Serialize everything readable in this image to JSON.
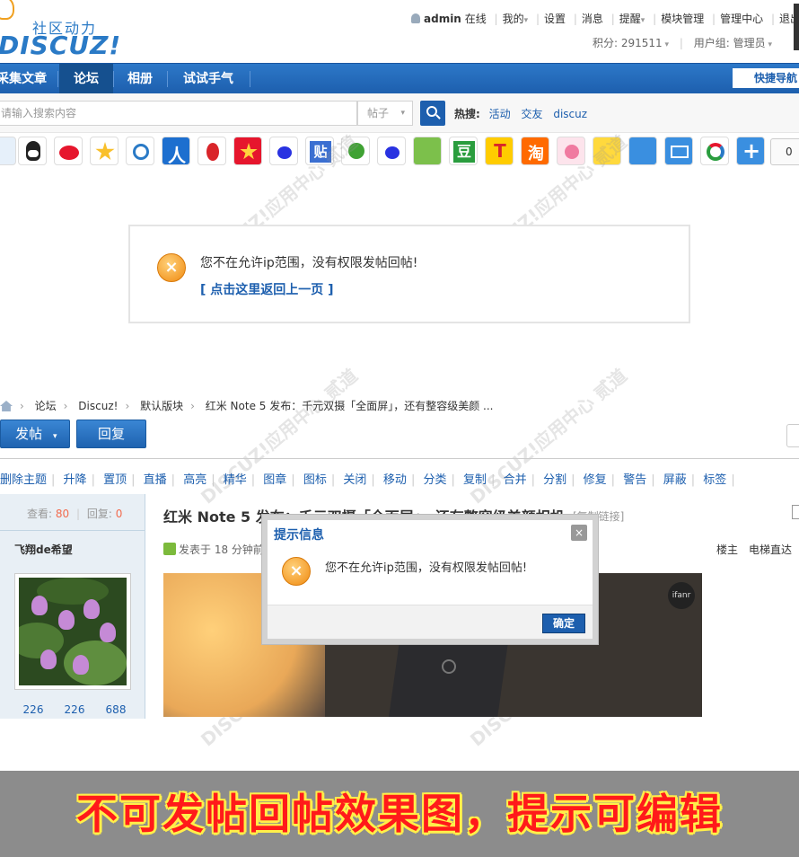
{
  "header": {
    "logo_sub": "社区动力",
    "logo_main": "DISCUZ!",
    "user": "admin",
    "online": "在线",
    "links": [
      "我的",
      "设置",
      "消息",
      "提醒",
      "模块管理",
      "管理中心",
      "退出"
    ],
    "points": "积分: 291511",
    "usergroup": "用户组: 管理员"
  },
  "nav": {
    "items": [
      "采集文章",
      "论坛",
      "相册",
      "试试手气"
    ],
    "quick": "快捷导航"
  },
  "search": {
    "placeholder": "请输入搜索内容",
    "type": "帖子",
    "hot_label": "热搜:",
    "hot": [
      "活动",
      "交友",
      "discuz"
    ]
  },
  "share": {
    "count": "0"
  },
  "notice": {
    "text": "您不在允许ip范围，没有权限发帖回帖!",
    "link": "[ 点击这里返回上一页 ]"
  },
  "breadcrumb": [
    "论坛",
    "Discuz!",
    "默认版块",
    "红米 Note 5 发布：千元双摄「全面屏」，还有整容级美颜 ..."
  ],
  "buttons": {
    "post": "发帖",
    "reply": "回复"
  },
  "modbar": [
    "删除主题",
    "升降",
    "置顶",
    "直播",
    "高亮",
    "精华",
    "图章",
    "图标",
    "关闭",
    "移动",
    "分类",
    "复制",
    "合并",
    "分割",
    "修复",
    "警告",
    "屏蔽",
    "标签"
  ],
  "thread": {
    "views_label": "查看:",
    "views": "80",
    "replies_label": "回复:",
    "replies": "0",
    "title": "红米 Note 5 发布：千元双摄「全面屏」，还有整容级美颜相机",
    "copy_link": "[复制链接]",
    "author": "飞翔de希望",
    "posted": "发表于 18 分钟前",
    "louzhu": "楼主",
    "dianti": "电梯直达",
    "user_stats": [
      "226",
      "226",
      "688"
    ],
    "photo_badge": "ifanr"
  },
  "dialog": {
    "title": "提示信息",
    "close": "×",
    "text": "您不在允许ip范围，没有权限发帖回帖!",
    "ok": "确定"
  },
  "banner": "不可发帖回帖效果图，提示可编辑"
}
